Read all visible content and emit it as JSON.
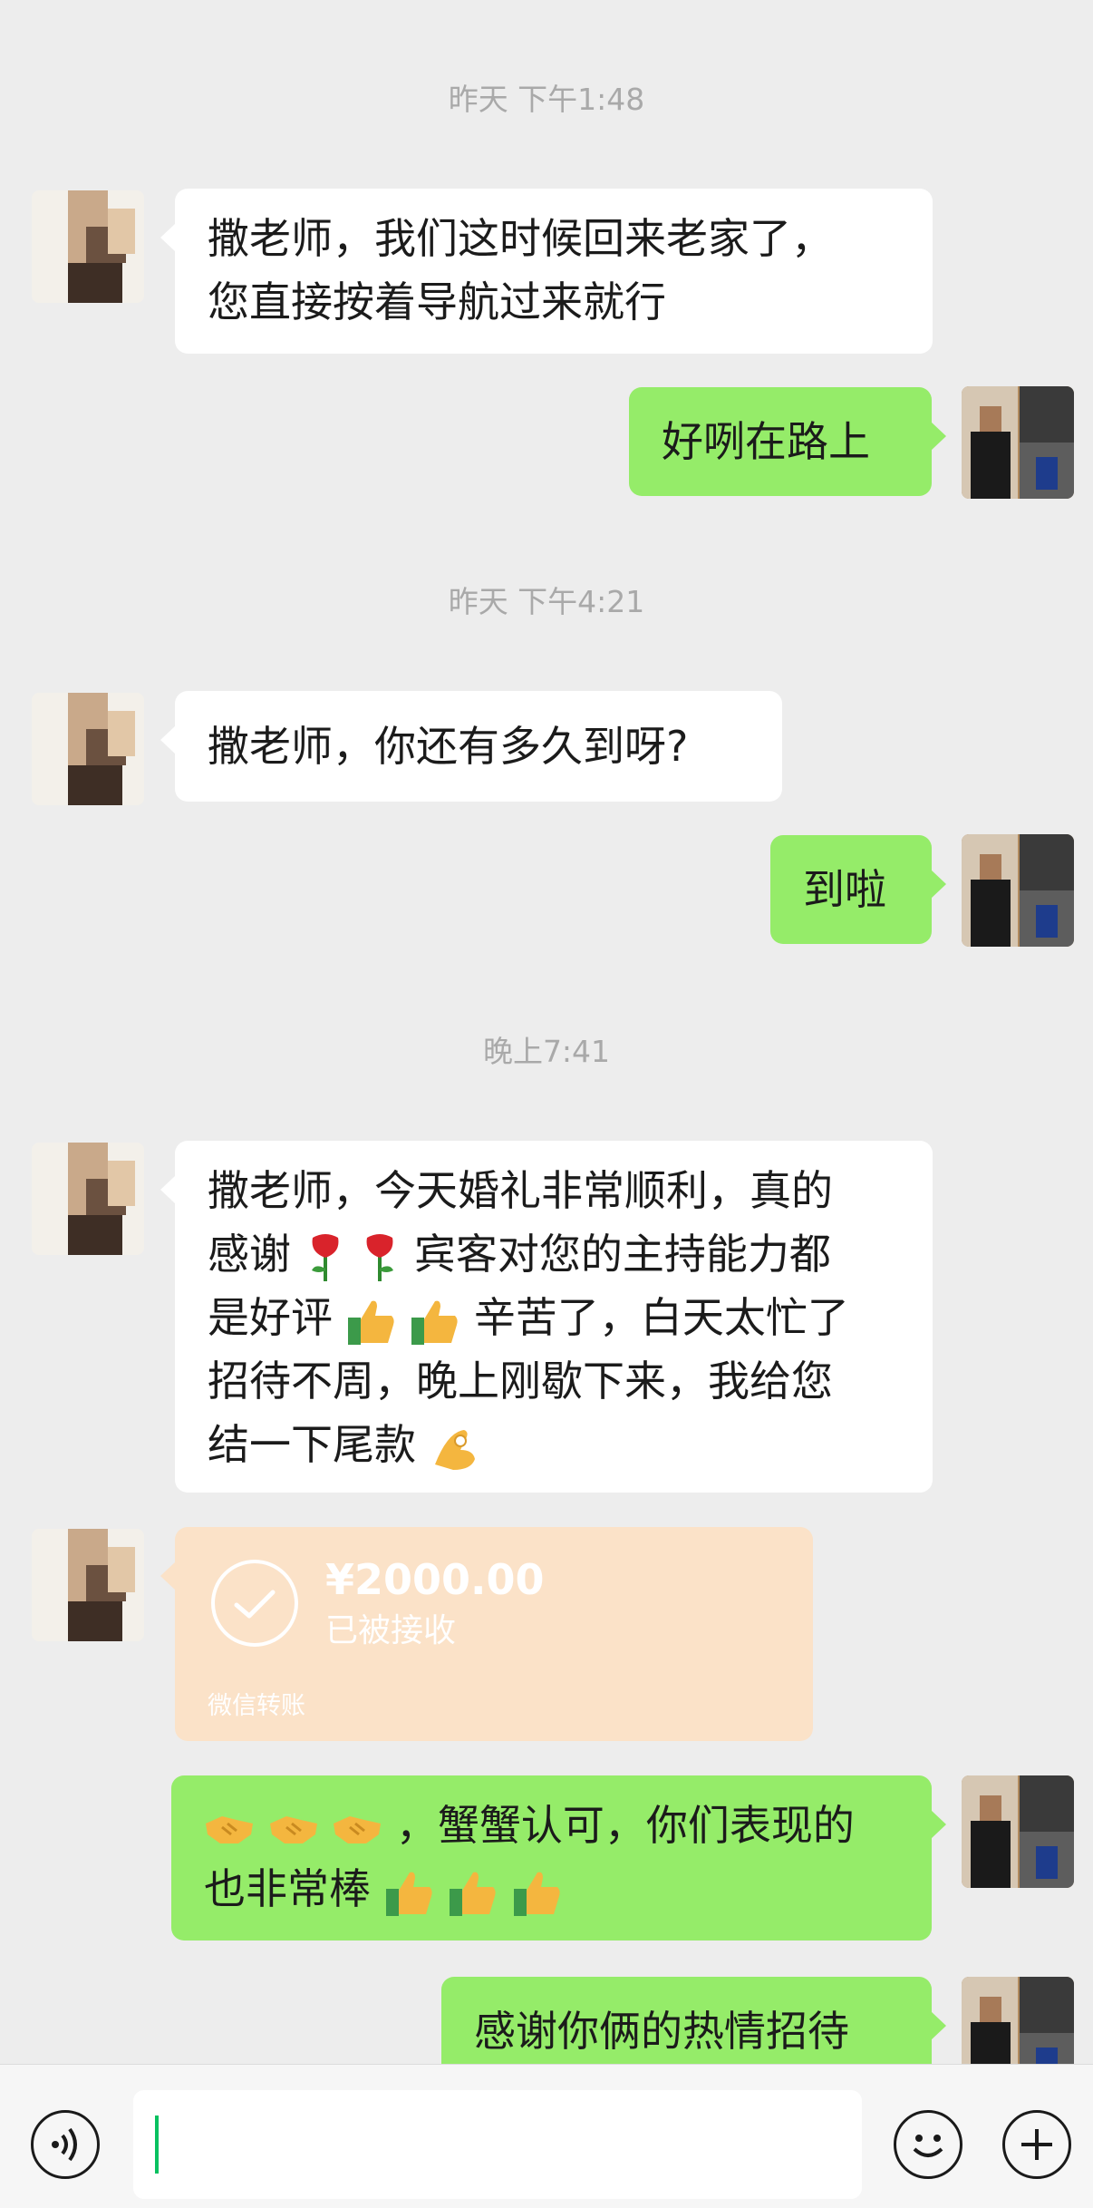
{
  "timestamps": [
    "昨天 下午1:48",
    "昨天 下午4:21",
    "晚上7:41"
  ],
  "messages": {
    "m1_line1": "撒老师，我们这时候回来老家了，",
    "m1_line2": "您直接按着导航过来就行",
    "m2": "好咧在路上",
    "m3": "撒老师，你还有多久到呀?",
    "m4": "到啦",
    "m5_line1": "撒老师，今天婚礼非常顺利，真的",
    "m5_line2a": "感谢",
    "m5_line2b": "宾客对您的主持能力都",
    "m5_line3a": "是好评",
    "m5_line3b": "辛苦了，白天太忙了",
    "m5_line4": "招待不周，晚上刚歇下来，我给您",
    "m5_line5": "结一下尾款",
    "m7_line1": "，蟹蟹认可，你们表现的",
    "m7_line2": "也非常棒",
    "m8": "感谢你俩的热情招待"
  },
  "transfer": {
    "amount": "¥2000.00",
    "status": "已被接收",
    "label": "微信转账"
  },
  "icons": {
    "voice": "voice-icon",
    "emoji": "emoji-icon",
    "plus": "plus-icon",
    "rose": "rose-emoji",
    "thumbs": "thumbs-up-emoji",
    "handshake": "handshake-emoji",
    "ok": "ok-hand-emoji"
  }
}
